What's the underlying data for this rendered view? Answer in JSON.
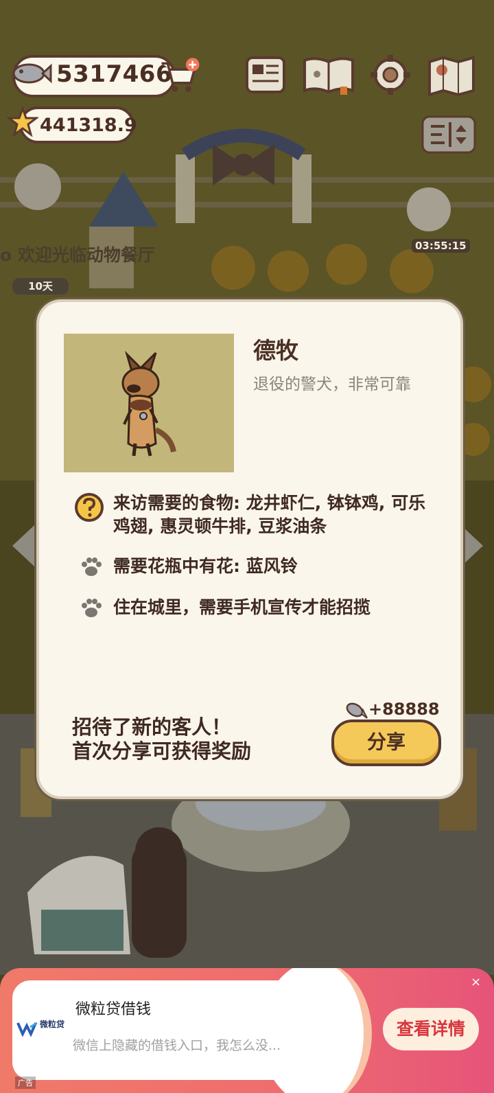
{
  "hud": {
    "fish_count": "5317466",
    "star_count": "441318.9",
    "timer": "03:55:15",
    "days": "10天",
    "welcome_sign": "o 欢迎光临动物餐厅"
  },
  "popup": {
    "customer_name": "德牧",
    "customer_desc": "退役的警犬，非常可靠",
    "requirements": [
      {
        "icon": "question-icon",
        "text": "来访需要的食物: 龙井虾仁, 钵钵鸡, 可乐鸡翅, 惠灵顿牛排, 豆浆油条"
      },
      {
        "icon": "paw-icon",
        "text": "需要花瓶中有花: 蓝风铃"
      },
      {
        "icon": "paw-icon",
        "text": "住在城里，需要手机宣传才能招揽"
      }
    ],
    "reward": "+88888",
    "invite_line1": "招待了新的客人！",
    "invite_line2": "首次分享可获得奖励",
    "share_label": "分享"
  },
  "ad": {
    "title": "微粒贷借钱",
    "subtitle": "微信上隐藏的借钱入口，我怎么没...",
    "brand": "微粒贷",
    "cta": "查看详情",
    "close": "×",
    "tag": "广告"
  },
  "colors": {
    "background_dim": "#3f3a1f",
    "popup_bg": "#fbf6ec",
    "share_button": "#f4c95a",
    "ad_gradient": "#ef6d6e"
  }
}
